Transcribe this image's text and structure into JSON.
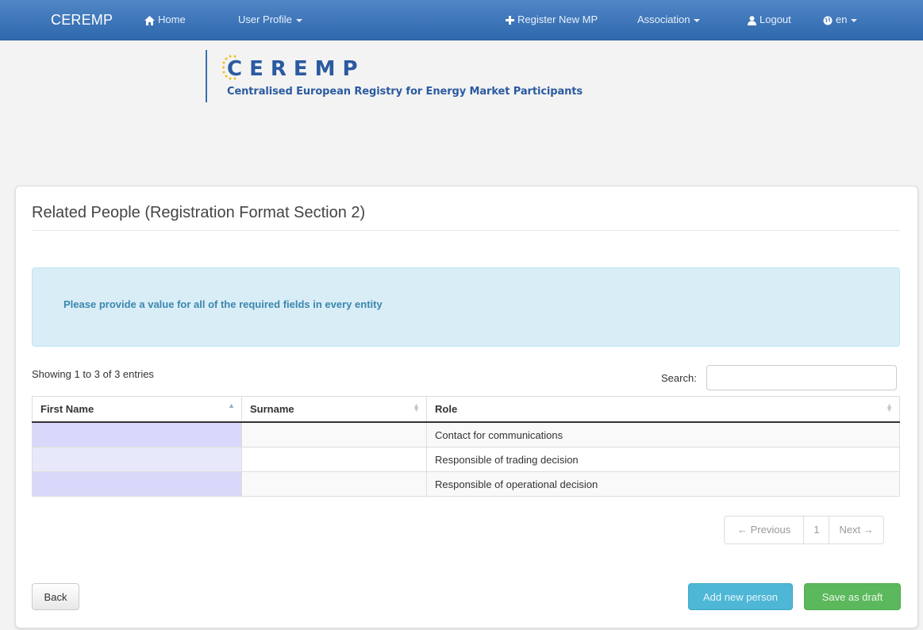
{
  "navbar": {
    "brand": "CEREMP",
    "home": "Home",
    "user_profile": "User Profile",
    "register": "Register New MP",
    "association": "Association",
    "logout": "Logout",
    "language": "en"
  },
  "logo": {
    "wordmark": "CEREMP",
    "subtitle": "Centralised European Registry for Energy Market Participants"
  },
  "page": {
    "title": "Related People (Registration Format Section 2)",
    "alert": "Please provide a value for all of the required fields in every entity"
  },
  "table": {
    "info": "Showing 1 to 3 of 3 entries",
    "search_label": "Search:",
    "search_value": "",
    "columns": [
      "First Name",
      "Surname",
      "Role"
    ],
    "rows": [
      {
        "first_name": "",
        "surname": "",
        "role": "Contact for communications"
      },
      {
        "first_name": "",
        "surname": "",
        "role": "Responsible of trading decision"
      },
      {
        "first_name": "",
        "surname": "",
        "role": "Responsible of operational decision"
      }
    ]
  },
  "pagination": {
    "previous": "← Previous",
    "page": "1",
    "next": "Next →"
  },
  "buttons": {
    "back": "Back",
    "add_person": "Add new person",
    "save_draft": "Save as draft"
  }
}
